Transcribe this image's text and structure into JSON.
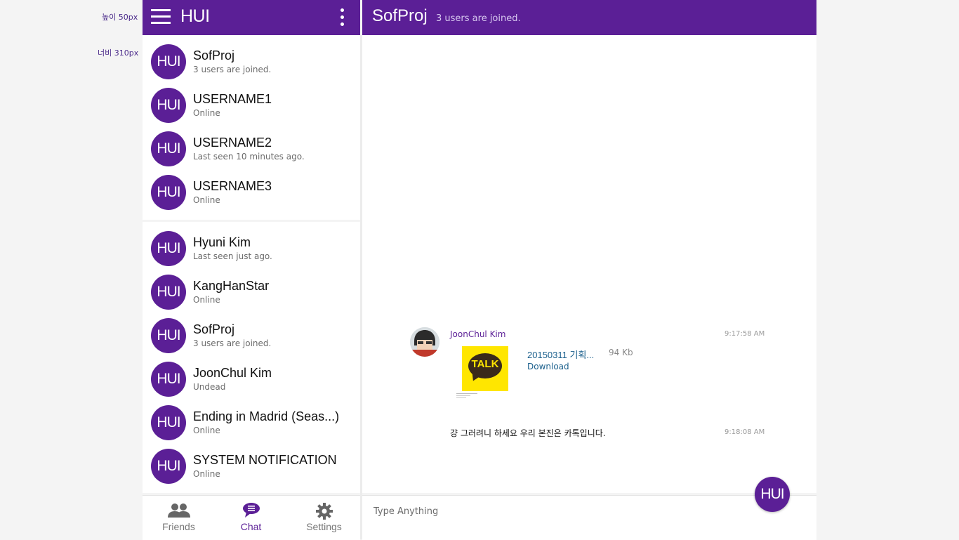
{
  "annotations": {
    "height_note": "높이 50px",
    "width_note": "너비 310px"
  },
  "app": {
    "brand": "HUI"
  },
  "chat_list_primary": [
    {
      "name": "SofProj",
      "status": "3 users are joined.",
      "avatar": "HUI"
    },
    {
      "name": "USERNAME1",
      "status": "Online",
      "avatar": "HUI"
    },
    {
      "name": "USERNAME2",
      "status": "Last seen 10 minutes ago.",
      "avatar": "HUI"
    },
    {
      "name": "USERNAME3",
      "status": "Online",
      "avatar": "HUI"
    }
  ],
  "chat_list_secondary": [
    {
      "name": "Hyuni Kim",
      "status": "Last seen just ago.",
      "avatar": "HUI"
    },
    {
      "name": "KangHanStar",
      "status": "Online",
      "avatar": "HUI"
    },
    {
      "name": "SofProj",
      "status": "3 users are joined.",
      "avatar": "HUI"
    },
    {
      "name": "JoonChul Kim",
      "status": "Undead",
      "avatar": "HUI"
    },
    {
      "name": "Ending in Madrid (Seas...)",
      "status": "Online",
      "avatar": "HUI"
    },
    {
      "name": "SYSTEM NOTIFICATION",
      "status": "Online",
      "avatar": "HUI"
    }
  ],
  "bottom_nav": [
    {
      "label": "Friends",
      "icon": "people-icon"
    },
    {
      "label": "Chat",
      "icon": "chat-bubble-icon",
      "active": true
    },
    {
      "label": "Settings",
      "icon": "gear-icon"
    }
  ],
  "room": {
    "title": "SofProj",
    "subtitle": "3 users are joined."
  },
  "messages": [
    {
      "sender": "JoonChul Kim",
      "time": "9:17:58 AM",
      "attachment": {
        "file_name": "20150311 기획...",
        "size": "94 Kb",
        "action": "Download",
        "thumb_label": "TALK"
      }
    },
    {
      "text": "걍 그러려니 하세요 우리 본진은 카톡입니다.",
      "time": "9:18:08 AM"
    }
  ],
  "compose": {
    "placeholder": "Type Anything"
  },
  "fab": {
    "label": "HUI"
  },
  "colors": {
    "primary": "#5b1f96",
    "link": "#1a5f8c"
  }
}
